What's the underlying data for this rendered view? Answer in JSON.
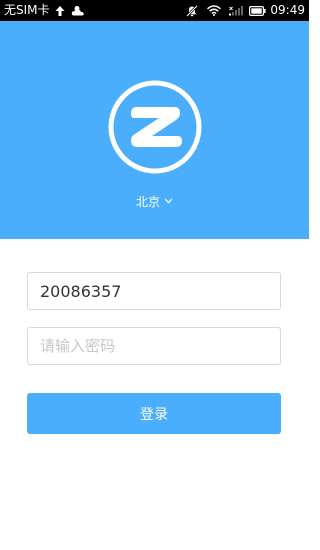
{
  "status_bar": {
    "carrier": "无SIM卡",
    "time": "09:49",
    "icons": [
      "upload-arrow-icon",
      "weather-icon",
      "notification-muted-icon",
      "wifi-icon",
      "cellular-signal-icon",
      "battery-icon"
    ]
  },
  "colors": {
    "brand": "#4aaefc",
    "status_bar": "#000000",
    "background": "#ffffff",
    "input_border": "#d9d9d9",
    "placeholder": "#c7c7c7"
  },
  "header": {
    "logo_icon": "z-logo-icon",
    "city": "北京",
    "city_dropdown_icon": "chevron-down-icon"
  },
  "login_form": {
    "username_value": "20086357",
    "password_placeholder": "请输入密码",
    "login_label": "登录"
  }
}
